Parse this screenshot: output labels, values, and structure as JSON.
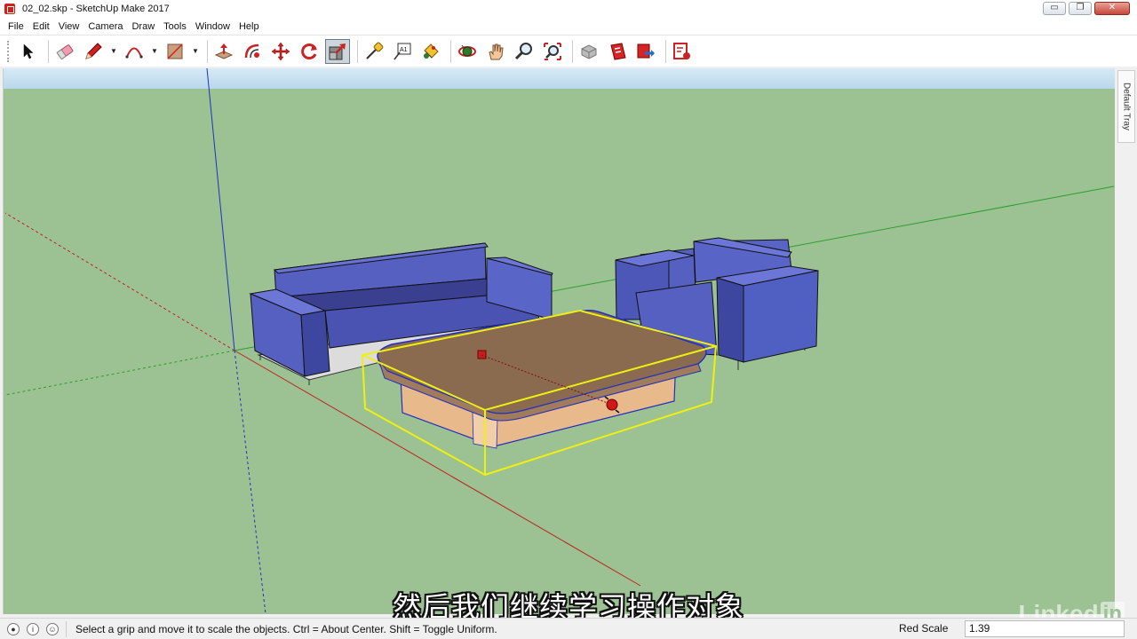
{
  "window": {
    "title": "02_02.skp - SketchUp Make 2017"
  },
  "window_controls": {
    "minimize": "▭",
    "maximize": "❐",
    "close": "✕"
  },
  "menu": [
    "File",
    "Edit",
    "View",
    "Camera",
    "Draw",
    "Tools",
    "Window",
    "Help"
  ],
  "toolbar": {
    "tools": [
      {
        "name": "select-tool-button",
        "icon": "select-arrow-icon"
      },
      {
        "name": "eraser-tool-button",
        "icon": "eraser-icon"
      },
      {
        "name": "pencil-tool-button",
        "icon": "pencil-icon"
      },
      {
        "name": "arc-tool-button",
        "icon": "arc-icon"
      },
      {
        "name": "rectangle-tool-button",
        "icon": "rectangle-icon"
      },
      {
        "name": "push-pull-tool-button",
        "icon": "push-pull-icon"
      },
      {
        "name": "offset-tool-button",
        "icon": "offset-icon"
      },
      {
        "name": "move-tool-button",
        "icon": "move-icon"
      },
      {
        "name": "rotate-tool-button",
        "icon": "rotate-icon"
      },
      {
        "name": "scale-tool-button",
        "icon": "scale-icon",
        "active": true
      },
      {
        "name": "tape-measure-tool-button",
        "icon": "tape-measure-icon"
      },
      {
        "name": "text-tool-button",
        "icon": "text-icon"
      },
      {
        "name": "paint-bucket-tool-button",
        "icon": "paint-bucket-icon"
      },
      {
        "name": "orbit-tool-button",
        "icon": "orbit-icon"
      },
      {
        "name": "pan-tool-button",
        "icon": "pan-hand-icon"
      },
      {
        "name": "zoom-tool-button",
        "icon": "zoom-icon"
      },
      {
        "name": "zoom-extents-tool-button",
        "icon": "zoom-extents-icon"
      },
      {
        "name": "warehouse-button",
        "icon": "3d-warehouse-icon"
      },
      {
        "name": "extension-warehouse-button",
        "icon": "extension-warehouse-icon"
      },
      {
        "name": "share-model-button",
        "icon": "share-model-icon"
      },
      {
        "name": "layout-button",
        "icon": "layout-icon"
      }
    ],
    "text_tool_label": "A1"
  },
  "tray": {
    "label": "Default Tray"
  },
  "colors": {
    "sky": "#c9e1f1",
    "ground": "#9cc293",
    "sofa": "#5560c0",
    "table_top": "#8b6b4f",
    "table_base": "#e8b98a",
    "selection": "#ffff33",
    "red_axis": "#c02020",
    "green_axis": "#20a020",
    "blue_axis": "#2030c0"
  },
  "subtitle": "然后我们继续学习操作对象",
  "watermark": {
    "brand": "Linked",
    "in": "in"
  },
  "status": {
    "icons": [
      "geo-location-icon",
      "info-icon",
      "user-icon"
    ],
    "message": "Select a grip and move it to scale the objects. Ctrl = About Center. Shift = Toggle Uniform.",
    "measure_label": "Red Scale",
    "measure_value": "1.39"
  }
}
